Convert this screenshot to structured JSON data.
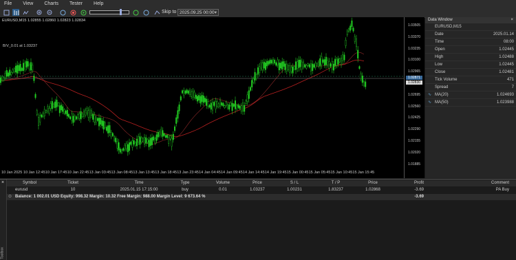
{
  "menu": [
    "File",
    "View",
    "Charts",
    "Tester",
    "Help"
  ],
  "toolbar": {
    "skip_label": "Skip to",
    "skip_value": "2025.09.25 00:00"
  },
  "chart": {
    "title": "EURUSD,M15  1.02855  1.02860  1.02823  1.02834",
    "label2": "B/V_0.01 at 1.03237",
    "price_labels": [
      "1.03505",
      "1.03370",
      "1.03235",
      "1.03100",
      "1.02965",
      "1.02830",
      "1.02695",
      "1.02560",
      "1.02425",
      "1.02290",
      "1.02155",
      "1.02020",
      "1.01885"
    ],
    "price_tag": "1.02871",
    "price_tag2": "1.02830",
    "time_labels": [
      "10 Jan 2025",
      "10 Jan 12:45",
      "10 Jan 17:45",
      "10 Jan 22:45",
      "13 Jan 03:45",
      "13 Jan 08:45",
      "13 Jan 13:45",
      "13 Jan 18:45",
      "13 Jan 23:45",
      "14 Jan 04:45",
      "14 Jan 09:45",
      "14 Jan 14:45",
      "14 Jan 19:45",
      "15 Jan 00:45",
      "15 Jan 05:45",
      "15 Jan 10:45",
      "15 Jan 15:45"
    ]
  },
  "data_window": {
    "title": "Data Window",
    "symbol": "EURUSD,M15",
    "rows": [
      {
        "k": "Date",
        "v": "2025.01.14"
      },
      {
        "k": "Time",
        "v": "08:00"
      },
      {
        "k": "Open",
        "v": "1.02445"
      },
      {
        "k": "High",
        "v": "1.02488"
      },
      {
        "k": "Low",
        "v": "1.02445"
      },
      {
        "k": "Close",
        "v": "1.02481"
      },
      {
        "k": "Tick Volume",
        "v": "471"
      },
      {
        "k": "Spread",
        "v": "7"
      },
      {
        "k": "MA(20)",
        "v": "1.024693"
      },
      {
        "k": "MA(50)",
        "v": "1.023988"
      }
    ]
  },
  "terminal": {
    "side_label": "Toolbox",
    "headers": [
      "Symbol",
      "Ticket",
      "Time",
      "Type",
      "Volume",
      "Price",
      "S / L",
      "T / P",
      "Price",
      "Profit",
      "Comment"
    ],
    "row": [
      "eurusd",
      "10",
      "2025.01.15 17:15:00",
      "buy",
      "0.01",
      "1.03237",
      "1.00231",
      "1.83237",
      "1.02868",
      "-3.69",
      "PA Buy"
    ],
    "balance": "Balance: 1 002.01 USD  Equity: 998.32  Margin: 10.32  Free Margin: 988.00  Margin Level: 9 673.64 %",
    "balance_profit": "-3.69"
  }
}
